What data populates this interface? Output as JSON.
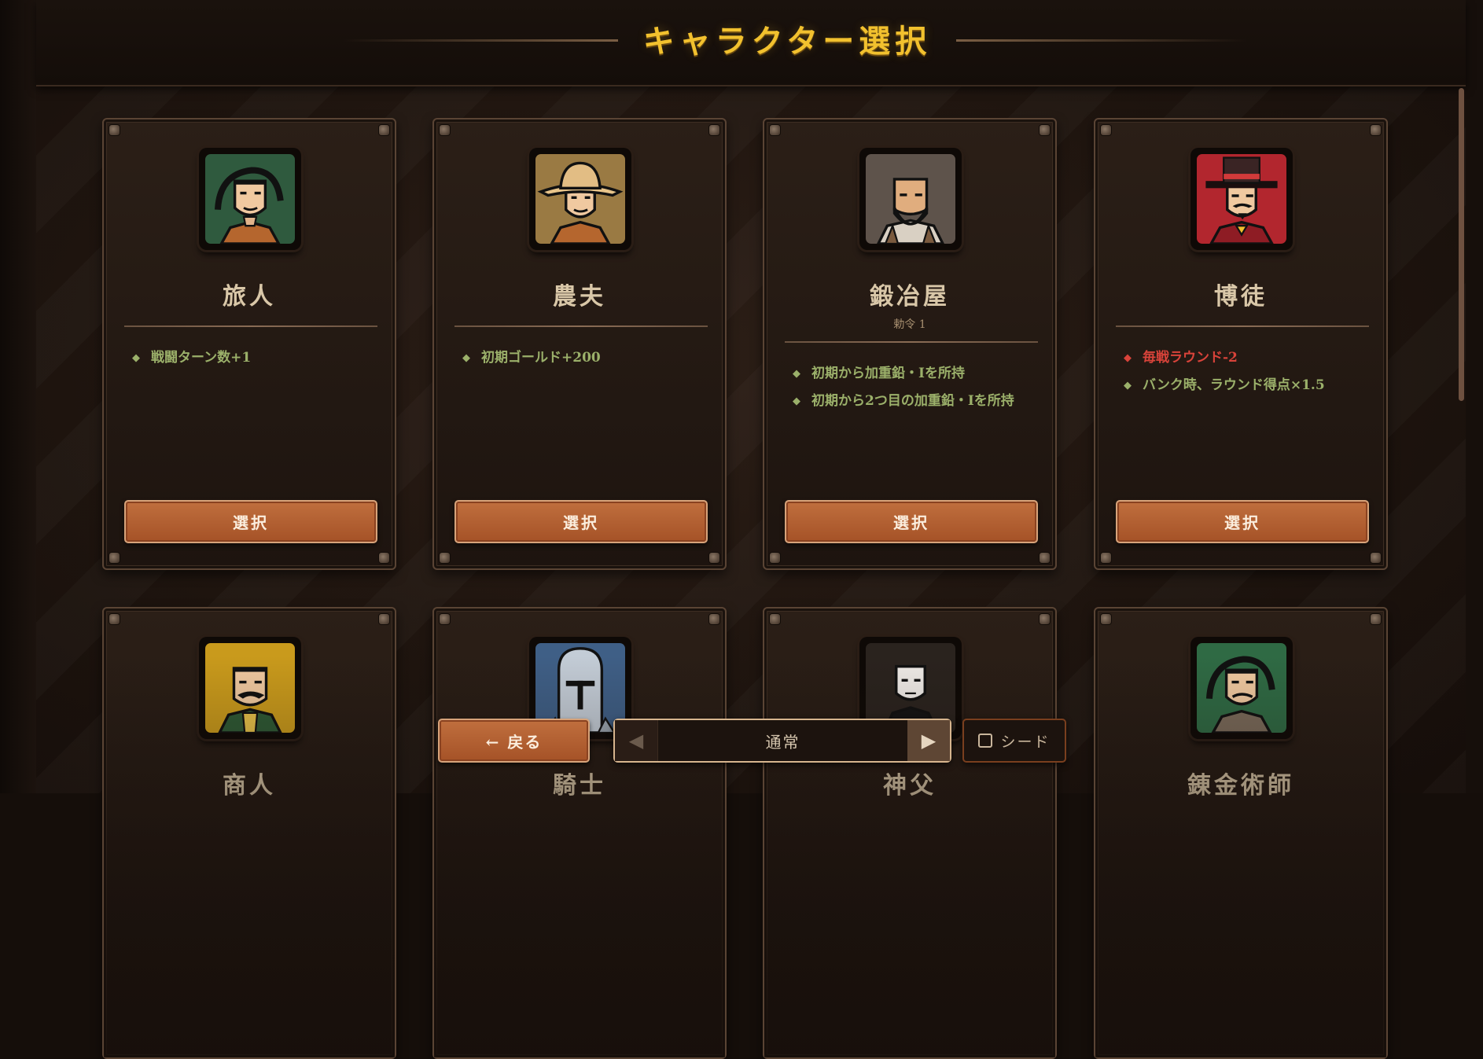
{
  "header": {
    "title": "キャラクター選択"
  },
  "cards": [
    {
      "name": "旅人",
      "sub": "",
      "traits": [
        {
          "text": "戦闘ターン数+1",
          "kind": "positive"
        }
      ],
      "select_label": "選択"
    },
    {
      "name": "農夫",
      "sub": "",
      "traits": [
        {
          "text": "初期ゴールド+200",
          "kind": "positive"
        }
      ],
      "select_label": "選択"
    },
    {
      "name": "鍛冶屋",
      "sub": "勅令 1",
      "traits": [
        {
          "text": "初期から加重鉛・Iを所持",
          "kind": "positive"
        },
        {
          "text": "初期から2つ目の加重鉛・Iを所持",
          "kind": "positive"
        }
      ],
      "select_label": "選択"
    },
    {
      "name": "博徒",
      "sub": "",
      "traits": [
        {
          "text": "毎戦ラウンド-2",
          "kind": "negative"
        },
        {
          "text": "バンク時、ラウンド得点×1.5",
          "kind": "positive"
        }
      ],
      "select_label": "選択"
    },
    {
      "name": "商人",
      "sub": "",
      "traits": [],
      "select_label": ""
    },
    {
      "name": "騎士",
      "sub": "",
      "traits": [],
      "select_label": ""
    },
    {
      "name": "神父",
      "sub": "",
      "traits": [],
      "select_label": ""
    },
    {
      "name": "錬金術師",
      "sub": "",
      "traits": [],
      "select_label": ""
    }
  ],
  "footer": {
    "back_label": "← 戻る",
    "difficulty_label": "通常",
    "prev_arrow": "◀",
    "next_arrow": "▶",
    "seed_label": "シード"
  },
  "icons": {
    "portraits": [
      "traveler-portrait-icon",
      "farmer-portrait-icon",
      "blacksmith-portrait-icon",
      "gambler-portrait-icon",
      "merchant-portrait-icon",
      "knight-portrait-icon",
      "priest-portrait-icon",
      "alchemist-portrait-icon"
    ],
    "trait_bullet": "◆"
  },
  "colors": {
    "title": "#f2c12e",
    "positive_trait": "#9bb06a",
    "negative_trait": "#d9433a",
    "select_button": "#b45f33"
  }
}
